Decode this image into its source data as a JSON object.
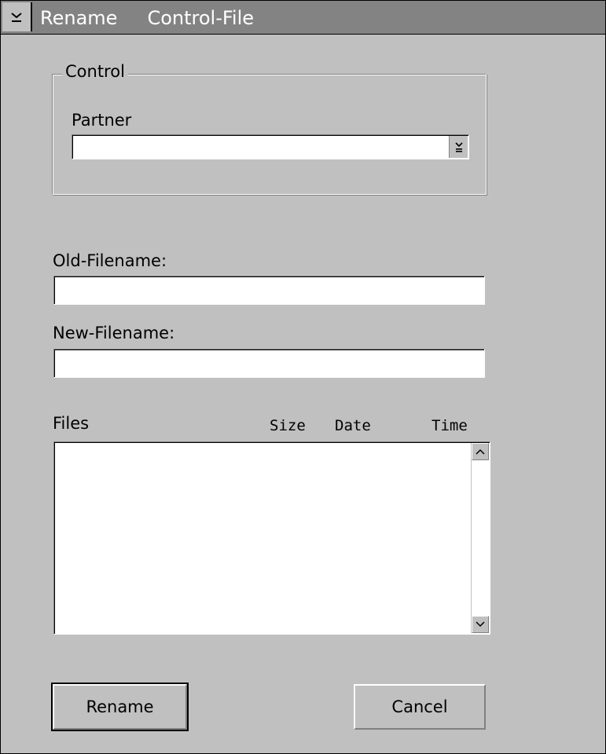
{
  "window": {
    "title": "Rename",
    "title_subject": "Control-File"
  },
  "control_group": {
    "label": "Control",
    "partner_label": "Partner",
    "partner_value": ""
  },
  "old_filename": {
    "label": "Old-Filename:",
    "value": ""
  },
  "new_filename": {
    "label": "New-Filename:",
    "value": ""
  },
  "files": {
    "label": "Files",
    "columns": [
      "Size",
      "Date",
      "Time"
    ],
    "items": []
  },
  "buttons": {
    "rename": "Rename",
    "cancel": "Cancel"
  },
  "icons": {
    "system_menu": "system-menu-icon",
    "combo_dropdown": "dropdown-arrow-icon",
    "scroll_up": "scroll-up-arrow-icon",
    "scroll_down": "scroll-down-arrow-icon"
  },
  "colors": {
    "dialog_background": "#c0c0c0",
    "titlebar_background": "#838383",
    "field_background": "#ffffff"
  }
}
